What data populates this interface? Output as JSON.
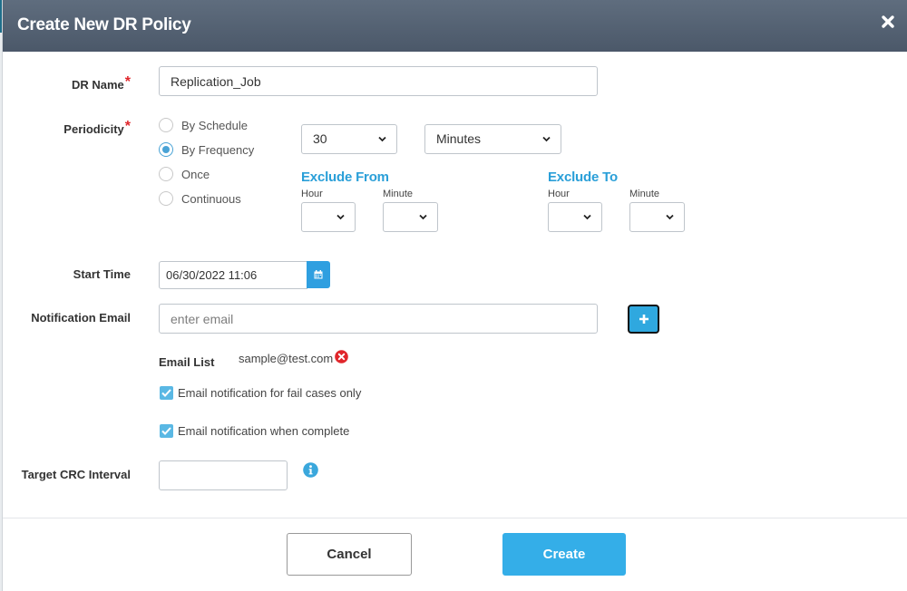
{
  "dialog": {
    "title": "Create New DR Policy"
  },
  "form": {
    "dr_name": {
      "label": "DR Name",
      "value": "Replication_Job"
    },
    "periodicity": {
      "label": "Periodicity",
      "options": [
        "By Schedule",
        "By Frequency",
        "Once",
        "Continuous"
      ],
      "selected": "By Frequency",
      "frequency_value": "30",
      "frequency_unit": "Minutes"
    },
    "exclude_from": {
      "title": "Exclude From",
      "hour_label": "Hour",
      "minute_label": "Minute",
      "hour": "",
      "minute": ""
    },
    "exclude_to": {
      "title": "Exclude To",
      "hour_label": "Hour",
      "minute_label": "Minute",
      "hour": "",
      "minute": ""
    },
    "start_time": {
      "label": "Start Time",
      "value": "06/30/2022 11:06"
    },
    "notification_email": {
      "label": "Notification Email",
      "placeholder": "enter email",
      "value": ""
    },
    "email_list": {
      "label": "Email List",
      "items": [
        "sample@test.com"
      ]
    },
    "notify_fail_only": {
      "label": "Email notification for fail cases only",
      "checked": true
    },
    "notify_complete": {
      "label": "Email notification when complete",
      "checked": true
    },
    "target_crc": {
      "label": "Target CRC Interval",
      "value": ""
    }
  },
  "buttons": {
    "cancel": "Cancel",
    "create": "Create"
  },
  "colors": {
    "header": "#56636f",
    "accent": "#34aee8",
    "required": "#e0262b",
    "section_title": "#2a9fd8"
  },
  "icons": {
    "close": "close-icon",
    "calendar": "calendar-icon",
    "add": "plus-icon",
    "remove": "remove-circle-icon",
    "info": "info-icon",
    "dropdown": "chevron-down-icon",
    "check": "check-icon"
  }
}
